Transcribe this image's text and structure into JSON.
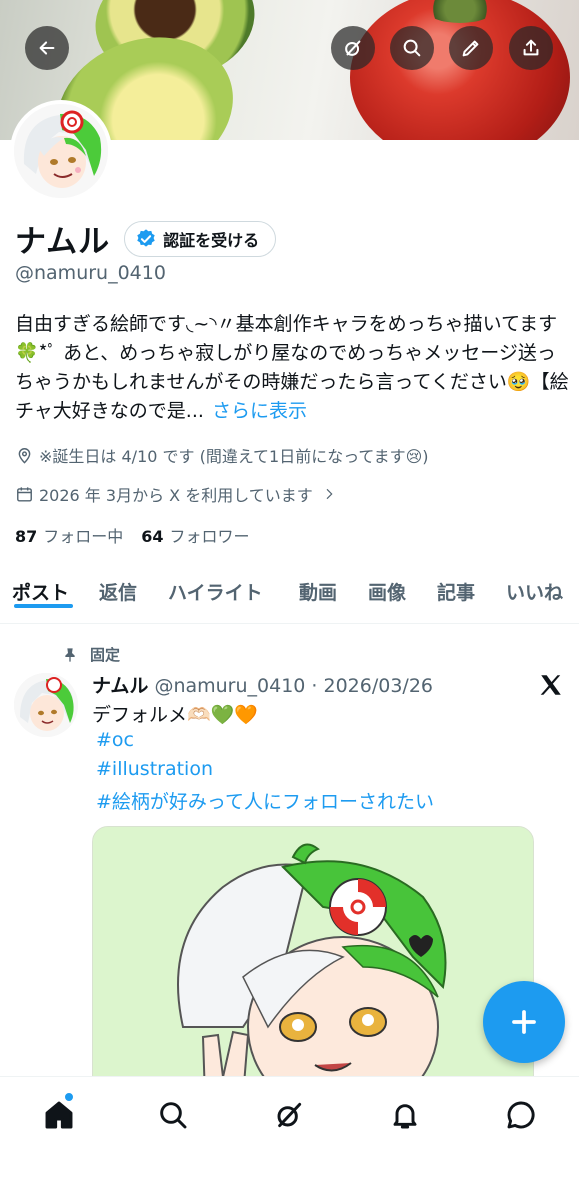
{
  "profile": {
    "display_name": "ナムル",
    "verify_button_label": "認証を受ける",
    "handle": "@namuru_0410",
    "bio": "自由すぎる絵師です◟~◝〃基本創作キャラをめっちゃ描いてます🍀*ﾟ あと、めっちゃ寂しがり屋なのでめっちゃメッセージ送っちゃうかもしれませんがその時嫌だったら言ってください🥹【絵チャ大好きなので是...",
    "show_more_label": "さらに表示",
    "birthday_text": "※誕生日は 4/10 です (間違えて1日前になってます😢)",
    "joined_text": "2026 年 3月から X を利用しています",
    "following_count": "87",
    "following_label": "フォロー中",
    "followers_count": "64",
    "followers_label": "フォロワー"
  },
  "tabs": [
    "ポスト",
    "返信",
    "ハイライト",
    "動画",
    "画像",
    "記事",
    "いいね"
  ],
  "post": {
    "pinned_label": "固定",
    "author_name": "ナムル",
    "author_handle_date": "@namuru_0410 · 2026/03/26",
    "text": "デフォルメ🫶🏻💚🧡",
    "hashtags": [
      "#oc",
      "#illustration",
      "#絵柄が好みって人にフォローされたい"
    ]
  },
  "icons": {
    "back": "arrow-left-icon",
    "grok": "grok-icon",
    "search": "search-icon",
    "edit": "pencil-icon",
    "share": "share-icon",
    "location": "location-pin-icon",
    "calendar": "calendar-icon",
    "pin": "pin-icon",
    "x_logo": "x-logo-icon",
    "compose": "plus-icon",
    "home": "home-icon",
    "explore": "search-icon",
    "grok_nav": "grok-icon",
    "notifications": "bell-icon",
    "messages": "message-icon"
  },
  "colors": {
    "accent": "#1d9bf0",
    "text_secondary": "#536471"
  }
}
